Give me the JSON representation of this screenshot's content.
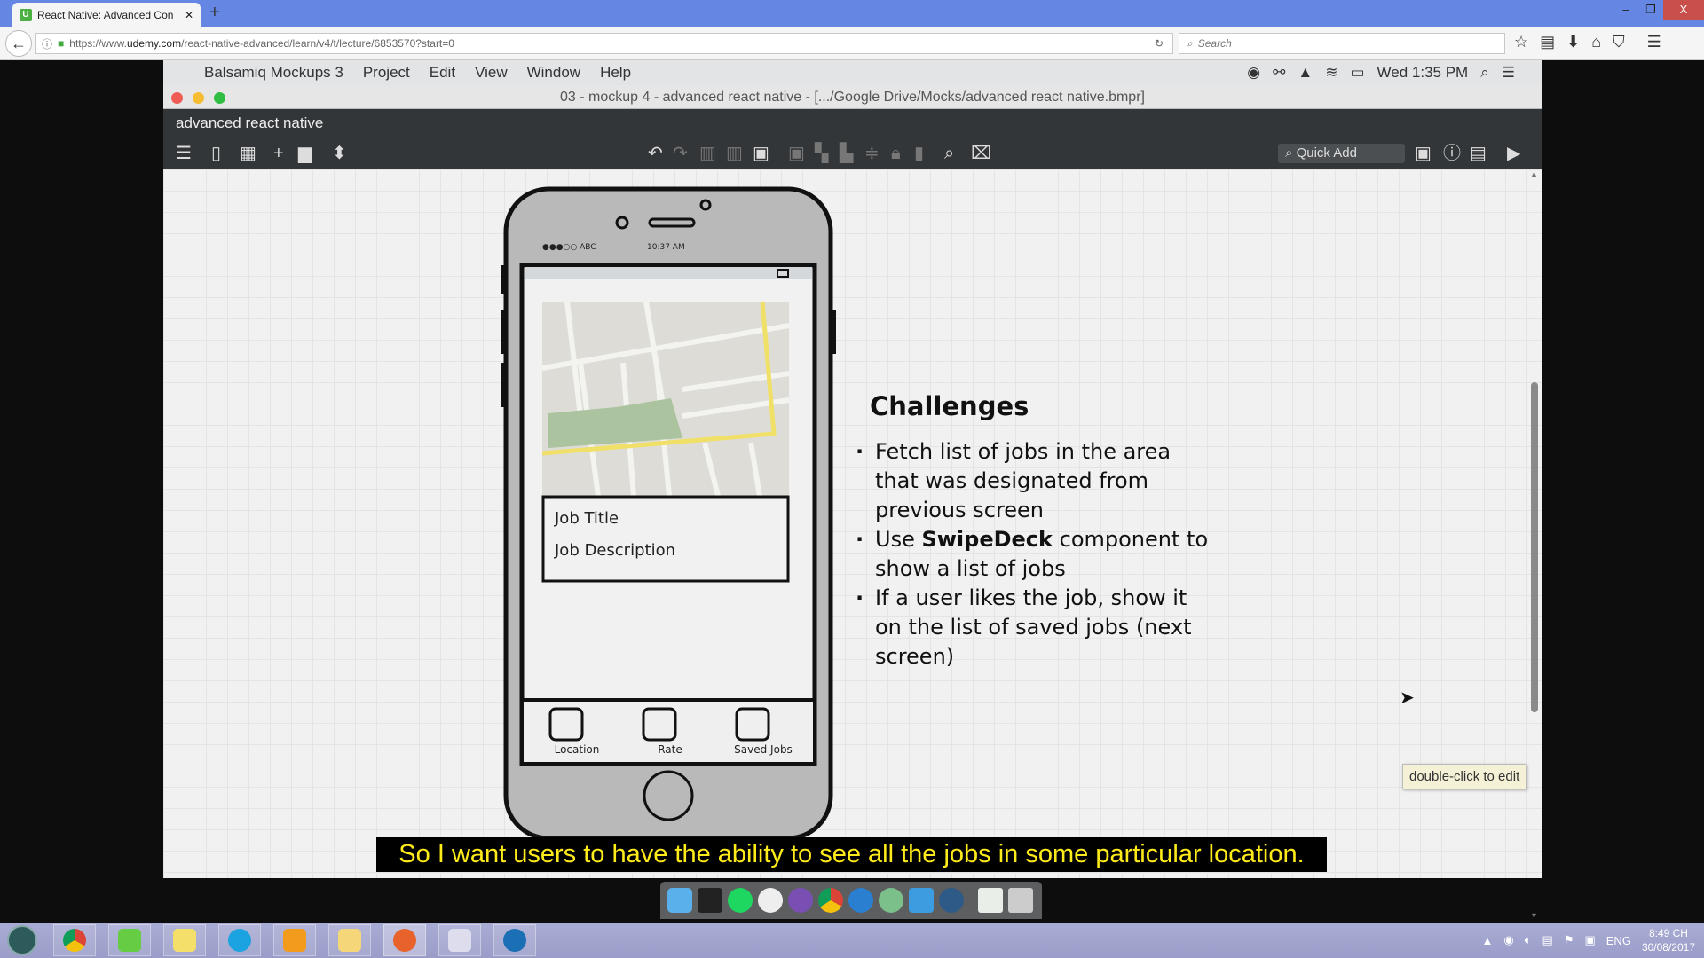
{
  "browser": {
    "tab_title": "React Native: Advanced Con",
    "tab_favicon": "U",
    "url_prefix": "https://www.",
    "url_domain": "udemy.com",
    "url_path": "/react-native-advanced/learn/v4/t/lecture/6853570?start=0",
    "search_placeholder": "Search"
  },
  "mac": {
    "menu": [
      "Balsamiq Mockups 3",
      "Project",
      "Edit",
      "View",
      "Window",
      "Help"
    ],
    "clock": "Wed 1:35 PM",
    "window_title": "03 - mockup 4 - advanced react native - [.../Google Drive/Mocks/advanced react native.bmpr]"
  },
  "app": {
    "project_name": "advanced react native",
    "quick_add": "Quick Add",
    "tooltip": "double-click to edit"
  },
  "mockup": {
    "status_carrier": "●●●○○ ABC",
    "status_time": "10:37 AM",
    "job_title": "Job Title",
    "job_description": "Job Description",
    "tabs": [
      "Location",
      "Rate",
      "Saved Jobs"
    ],
    "heading": "Challenges",
    "bullets": [
      {
        "pre": "Fetch list of jobs in the area that was designated from previous screen",
        "bold": "",
        "post": ""
      },
      {
        "pre": "Use ",
        "bold": "SwipeDeck",
        "post": " component to show a list of jobs"
      },
      {
        "pre": "If a user likes the job, show it on the list of saved jobs (next screen)",
        "bold": "",
        "post": ""
      }
    ]
  },
  "subtitle": "So I want users to have the ability to see all the jobs in some particular location.",
  "taskbar": {
    "lang": "ENG",
    "time": "8:49 CH",
    "date": "30/08/2017"
  },
  "colors": {
    "subtitle_text": "#ffeb1a",
    "map_road": "#f0e068",
    "map_park": "#abc39e"
  }
}
